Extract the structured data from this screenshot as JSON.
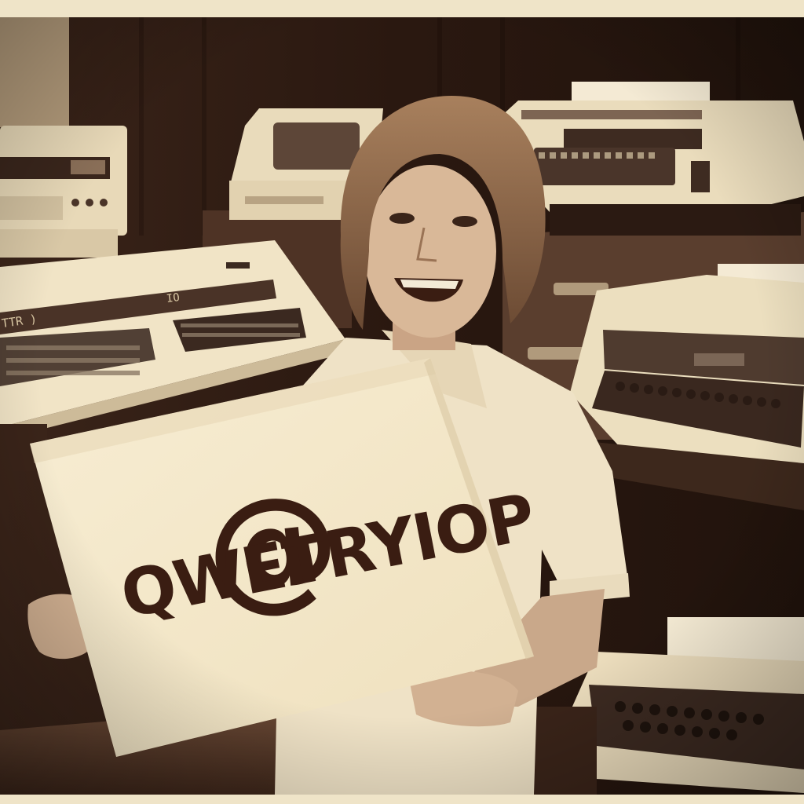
{
  "image": {
    "sign": {
      "symbol": "@",
      "text": "QWETRYIOP"
    },
    "keyboard_labels": [
      "TTR )",
      "IO"
    ],
    "palette": {
      "background": "#1f120d",
      "paper": "#f5ead0",
      "ink": "#3a1d12",
      "machine": "#efe2c3",
      "keys": "#3c2a22",
      "border": "#efe4c8"
    }
  }
}
